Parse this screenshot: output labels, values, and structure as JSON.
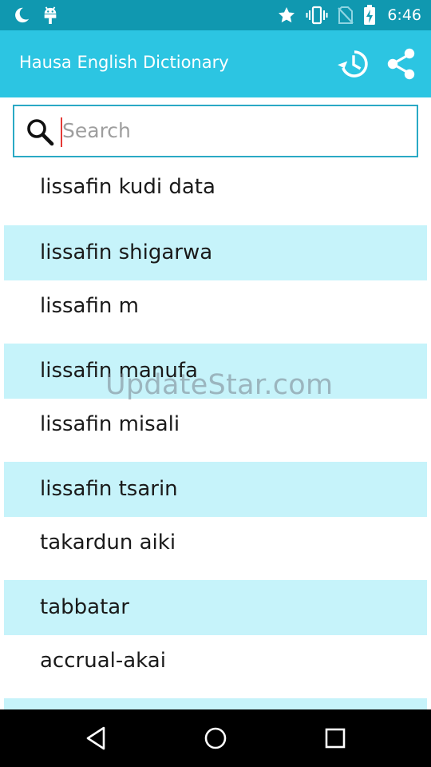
{
  "status_bar": {
    "time": "6:46",
    "icons": [
      "moon-icon",
      "android-icon",
      "star-icon",
      "vibrate-icon",
      "no-sim-icon",
      "battery-charging-icon"
    ]
  },
  "app_bar": {
    "title": "Hausa English Dictionary",
    "actions": [
      "history-icon",
      "share-icon"
    ]
  },
  "search": {
    "placeholder": "Search",
    "value": ""
  },
  "list": {
    "items": [
      "lissafin kudi data",
      "lissafin shigarwa",
      "lissafin m",
      "lissafin manufa",
      "lissafin misali",
      "lissafin tsarin",
      "takardun aiki",
      "tabbatar",
      "accrual-akai",
      ""
    ]
  },
  "watermark": "UpdateStar.com",
  "nav_bar": {
    "buttons": [
      "back-icon",
      "home-icon",
      "recents-icon"
    ]
  },
  "colors": {
    "status_bar": "#1098b0",
    "app_bar": "#2cc5e2",
    "row_highlight": "#c6f3fa",
    "search_border": "#2aa9c5"
  }
}
